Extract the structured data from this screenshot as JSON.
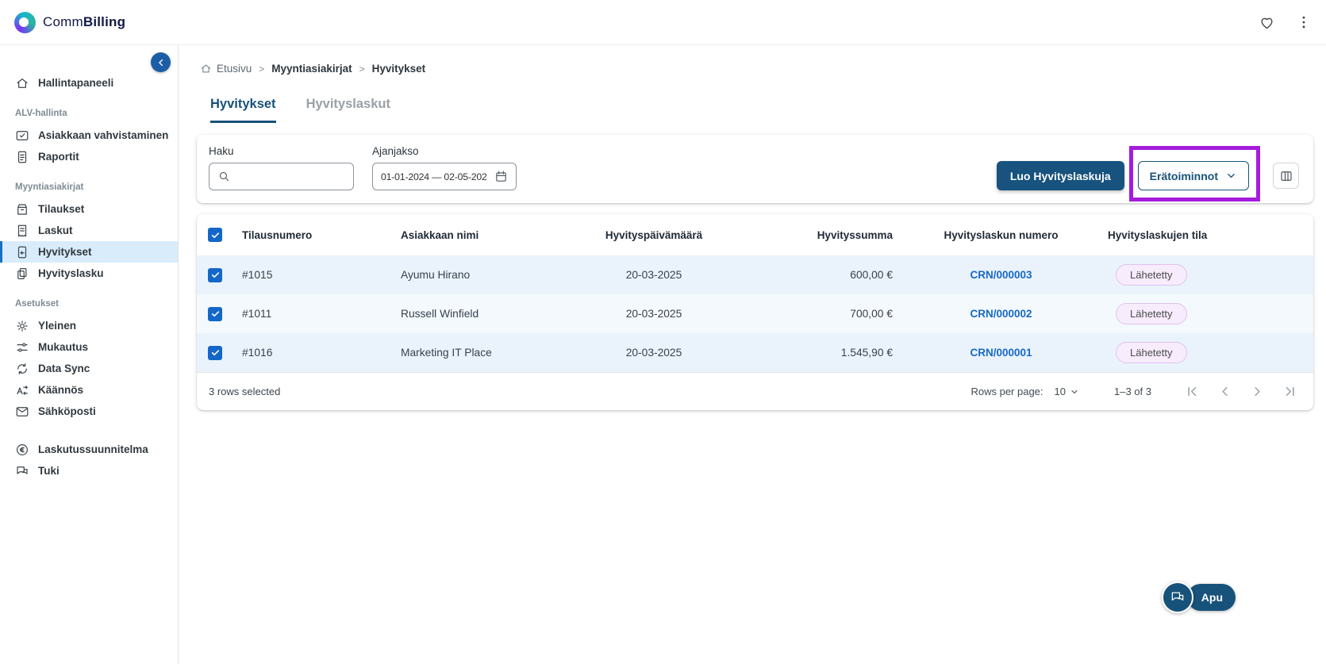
{
  "topbar": {
    "brand_regular": "Comm",
    "brand_bold": "Billing"
  },
  "sidebar": {
    "main_item": {
      "label": "Hallintapaneeli"
    },
    "sections": [
      {
        "label": "ALV-hallinta",
        "items": [
          {
            "label": "Asiakkaan vahvistaminen"
          },
          {
            "label": "Raportit"
          }
        ]
      },
      {
        "label": "Myyntiasiakirjat",
        "items": [
          {
            "label": "Tilaukset"
          },
          {
            "label": "Laskut"
          },
          {
            "label": "Hyvitykset"
          },
          {
            "label": "Hyvityslasku"
          }
        ]
      },
      {
        "label": "Asetukset",
        "items": [
          {
            "label": "Yleinen"
          },
          {
            "label": "Mukautus"
          },
          {
            "label": "Data Sync"
          },
          {
            "label": "Käännös"
          },
          {
            "label": "Sähköposti"
          }
        ]
      }
    ],
    "footer_items": [
      {
        "label": "Laskutussuunnitelma"
      },
      {
        "label": "Tuki"
      }
    ]
  },
  "breadcrumb": {
    "home": "Etusivu",
    "level2": "Myyntiasiakirjat",
    "level3": "Hyvitykset"
  },
  "tabs": {
    "tab1": "Hyvitykset",
    "tab2": "Hyvityslaskut"
  },
  "filters": {
    "search_label": "Haku",
    "date_label": "Ajanjakso",
    "date_value": "01-01-2024 — 02-05-202",
    "create_button": "Luo Hyvityslaskuja",
    "bulk_button": "Erätoiminnot"
  },
  "table": {
    "headers": {
      "order": "Tilausnumero",
      "customer": "Asiakkaan nimi",
      "date": "Hyvityspäivämäärä",
      "amount": "Hyvityssumma",
      "credit_note": "Hyvityslaskun numero",
      "status": "Hyvityslaskujen tila"
    },
    "rows": [
      {
        "order": "#1015",
        "customer": "Ayumu Hirano",
        "date": "20-03-2025",
        "amount": "600,00 €",
        "credit_note": "CRN/000003",
        "status": "Lähetetty"
      },
      {
        "order": "#1011",
        "customer": "Russell Winfield",
        "date": "20-03-2025",
        "amount": "700,00 €",
        "credit_note": "CRN/000002",
        "status": "Lähetetty"
      },
      {
        "order": "#1016",
        "customer": "Marketing IT Place",
        "date": "20-03-2025",
        "amount": "1.545,90 €",
        "credit_note": "CRN/000001",
        "status": "Lähetetty"
      }
    ],
    "footer": {
      "selected": "3 rows selected",
      "rows_per_page_label": "Rows per page:",
      "rows_per_page_value": "10",
      "range": "1–3 of 3"
    }
  },
  "help": {
    "label": "Apu"
  },
  "icons": {
    "kebab-icon": "⋮",
    "heart-icon": "♡ outline",
    "search-icon": "magnifier",
    "calendar-icon": "calendar",
    "columns-icon": "table columns",
    "chevron-down-icon": "▾",
    "chevron-left-icon": "‹",
    "home-icon": "house",
    "chat-icon": "speech bubbles"
  },
  "colors": {
    "primary_navy": "#17537e",
    "link_blue": "#1769c6",
    "checkbox_blue": "#1467c8",
    "active_item_bg": "#d9ecfb",
    "row_selected_bg": "#eaf3fc",
    "chip_bg": "#f7ecfc",
    "chip_border": "#dfc2ef",
    "annotation_purple": "#a51cdc"
  }
}
